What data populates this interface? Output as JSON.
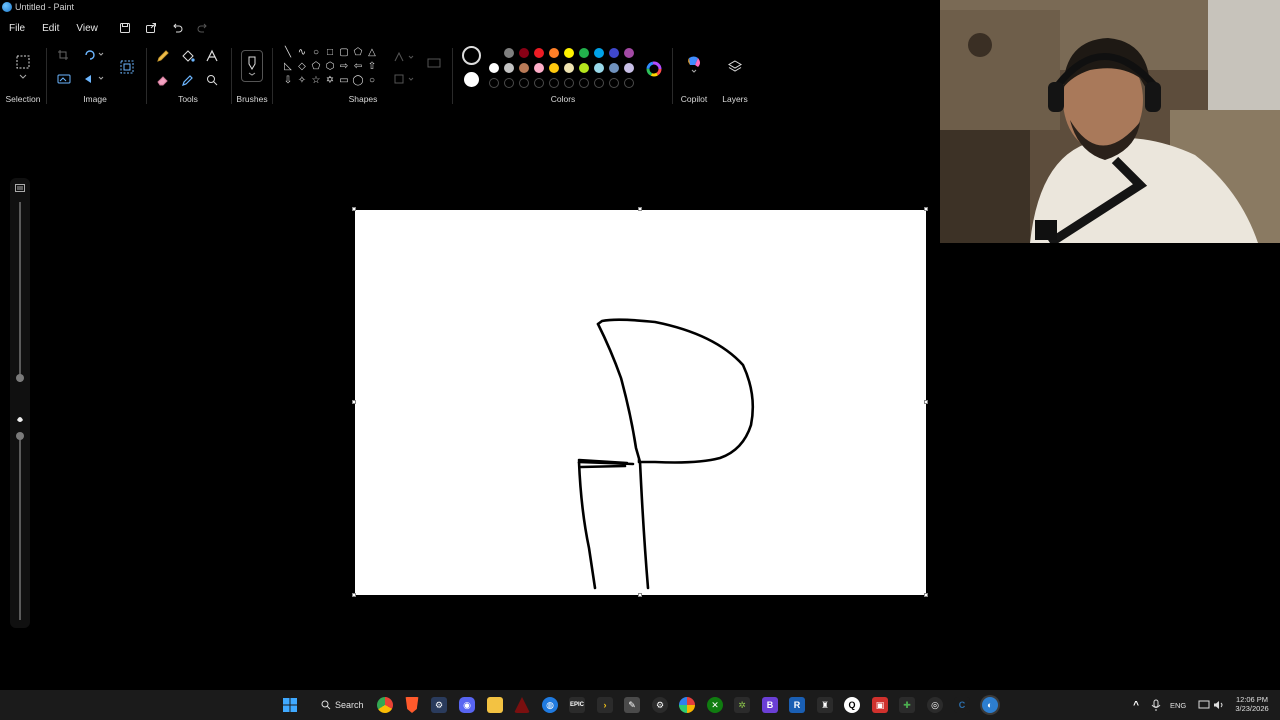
{
  "window": {
    "title": "Untitled - Paint"
  },
  "menu": {
    "file": "File",
    "edit": "Edit",
    "view": "View"
  },
  "ribbon": {
    "groups": {
      "selection": "Selection",
      "image": "Image",
      "tools": "Tools",
      "brushes": "Brushes",
      "shapes": "Shapes",
      "colors": "Colors",
      "copilot": "Copilot",
      "layers": "Layers"
    },
    "shapes": [
      "line",
      "curve",
      "oval",
      "rectangle",
      "rounded-rectangle",
      "polygon",
      "triangle",
      "right-triangle",
      "diamond",
      "pentagon",
      "hexagon",
      "right-arrow",
      "left-arrow",
      "up-arrow",
      "down-arrow",
      "four-point-star",
      "five-point-star",
      "six-point-star",
      "rounded-callout",
      "oval-callout",
      "cloud-callout"
    ],
    "primary_color": "#000000",
    "secondary_color": "#ffffff",
    "palette_row1": [
      "#000000",
      "#7f7f7f",
      "#880015",
      "#ed1c24",
      "#ff7f27",
      "#fff200",
      "#22b14c",
      "#00a2e8",
      "#3f48cc",
      "#a349a4"
    ],
    "palette_row2": [
      "#ffffff",
      "#c3c3c3",
      "#b97a57",
      "#ffaec9",
      "#ffc90e",
      "#efe4b0",
      "#b5e61d",
      "#99d9ea",
      "#7092be",
      "#c8bfe7"
    ]
  },
  "taskbar": {
    "search_label": "Search",
    "lang": "ENG",
    "time": "12:06 PM",
    "date": "3/23/2026"
  }
}
